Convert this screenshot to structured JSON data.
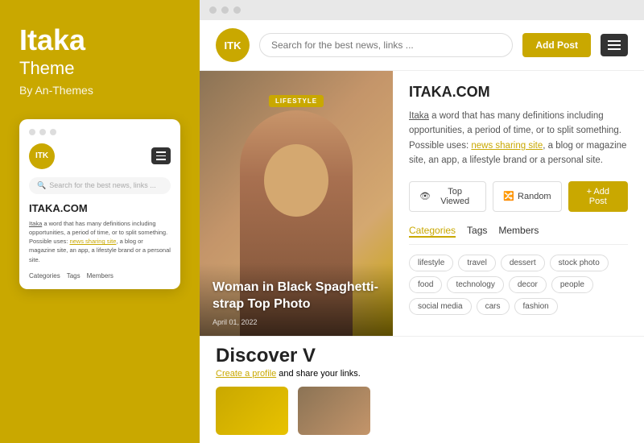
{
  "left": {
    "brand_title": "Itaka",
    "brand_subtitle": "Theme",
    "brand_by": "By An-Themes",
    "logo_text": "ITK",
    "mockup": {
      "logo_text": "ITK",
      "search_placeholder": "Search for the best news, links ...",
      "site_title": "ITAKA.COM",
      "description": "Itaka a word that has many definitions including opportunities, a period of time, or to split something. Possible uses: news sharing site, a blog or magazine site, an app, a lifestyle brand or a personal site.",
      "nav_items": [
        "Categories",
        "Tags",
        "Members"
      ],
      "link_text": "news sharing site"
    }
  },
  "right": {
    "browser_dots": [
      "dot1",
      "dot2",
      "dot3"
    ],
    "nav": {
      "logo_text": "ITK",
      "search_placeholder": "Search for the best news, links ...",
      "add_post_label": "Add Post"
    },
    "hero": {
      "badge": "LIFESTYLE",
      "title": "Woman in Black Spaghetti-strap Top Photo",
      "date": "April 01, 2022"
    },
    "sidebar": {
      "site_title": "ITAKA.COM",
      "description_parts": {
        "before_link": "Itaka",
        "middle": " a word that has many definitions including opportunities, a period of time, or to split something. Possible uses: ",
        "link": "news sharing site",
        "after_link": ", a blog or magazine site, an app, a lifestyle brand or a personal site."
      },
      "buttons": {
        "top_viewed": "Top Viewed",
        "random": "Random",
        "add_post": "+ Add Post"
      },
      "tabs": [
        "Categories",
        "Tags",
        "Members"
      ],
      "tags": [
        "lifestyle",
        "travel",
        "dessert",
        "stock photo",
        "food",
        "technology",
        "decor",
        "people",
        "social media",
        "cars",
        "fashion"
      ]
    },
    "discover": {
      "title": "Discover V",
      "subtitle_link": "Create a profile",
      "subtitle_rest": " and share your links."
    }
  }
}
